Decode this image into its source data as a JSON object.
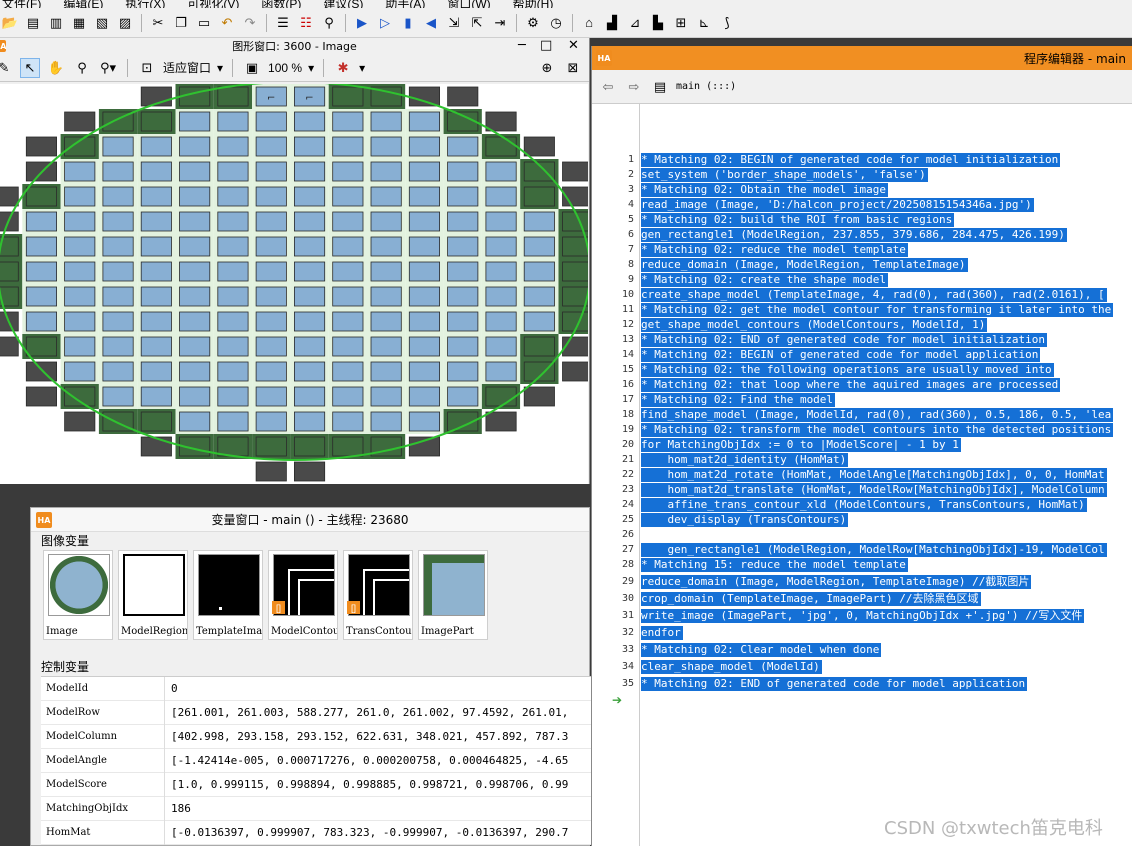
{
  "menu": [
    "文件(F)",
    "编辑(E)",
    "执行(X)",
    "可视化(V)",
    "函数(P)",
    "建议(S)",
    "助手(A)",
    "窗口(W)",
    "帮助(H)"
  ],
  "graphics_window": {
    "title": "图形窗口: 3600 - Image",
    "fit_label": "适应窗口",
    "zoom_label": "100 %"
  },
  "variable_window": {
    "title": "变量窗口 - main () - 主线程: 23680",
    "iconic_section": "图像变量",
    "control_section": "控制变量",
    "iconic_vars": [
      {
        "name": "Image",
        "kind": "wafer",
        "badge": ""
      },
      {
        "name": "ModelRegion",
        "kind": "white",
        "badge": ""
      },
      {
        "name": "TemplateImage",
        "kind": "black-dot",
        "badge": ""
      },
      {
        "name": "ModelContours",
        "kind": "contours",
        "badge": "[]"
      },
      {
        "name": "TransContours",
        "kind": "contours2",
        "badge": "[]"
      },
      {
        "name": "ImagePart",
        "kind": "part",
        "badge": ""
      }
    ],
    "control_vars": [
      {
        "name": "ModelId",
        "value": "0"
      },
      {
        "name": "ModelRow",
        "value": "[261.001, 261.003, 588.277, 261.0, 261.002, 97.4592, 261.01,"
      },
      {
        "name": "ModelColumn",
        "value": "[402.998, 293.158, 293.152, 622.631, 348.021, 457.892, 787.3"
      },
      {
        "name": "ModelAngle",
        "value": "[-1.42414e-005, 0.000717276, 0.000200758, 0.000464825, -4.65"
      },
      {
        "name": "ModelScore",
        "value": "[1.0, 0.999115, 0.998894, 0.998885, 0.998721, 0.998706, 0.99"
      },
      {
        "name": "MatchingObjIdx",
        "value": "186"
      },
      {
        "name": "HomMat",
        "value": "[-0.0136397, 0.999907, 783.323, -0.999907, -0.0136397, 290.7"
      }
    ]
  },
  "program_editor": {
    "title": "程序编辑器 - main",
    "procedure": "main (:::)",
    "lines": [
      "* Matching 02: BEGIN of generated code for model initialization",
      "set_system ('border_shape_models', 'false')",
      "* Matching 02: Obtain the model image",
      "read_image (Image, 'D:/halcon_project/20250815154346a.jpg')",
      "* Matching 02: build the ROI from basic regions",
      "gen_rectangle1 (ModelRegion, 237.855, 379.686, 284.475, 426.199)",
      "* Matching 02: reduce the model template",
      "reduce_domain (Image, ModelRegion, TemplateImage)",
      "* Matching 02: create the shape model",
      "create_shape_model (TemplateImage, 4, rad(0), rad(360), rad(2.0161), [",
      "* Matching 02: get the model contour for transforming it later into the",
      "get_shape_model_contours (ModelContours, ModelId, 1)",
      "* Matching 02: END of generated code for model initialization",
      "* Matching 02: BEGIN of generated code for model application",
      "* Matching 02: the following operations are usually moved into",
      "* Matching 02: that loop where the aquired images are processed",
      "* Matching 02: Find the model",
      "find_shape_model (Image, ModelId, rad(0), rad(360), 0.5, 186, 0.5, 'lea",
      "* Matching 02: transform the model contours into the detected positions",
      "for MatchingObjIdx := 0 to |ModelScore| - 1 by 1",
      "    hom_mat2d_identity (HomMat)",
      "    hom_mat2d_rotate (HomMat, ModelAngle[MatchingObjIdx], 0, 0, HomMat",
      "    hom_mat2d_translate (HomMat, ModelRow[MatchingObjIdx], ModelColumn",
      "    affine_trans_contour_xld (ModelContours, TransContours, HomMat)",
      "    dev_display (TransContours)",
      "",
      "    gen_rectangle1 (ModelRegion, ModelRow[MatchingObjIdx]-19, ModelCol",
      "* Matching 15: reduce the model template",
      "reduce_domain (Image, ModelRegion, TemplateImage) //截取图片",
      "crop_domain (TemplateImage, ImagePart) //去除黑色区域",
      "write_image (ImagePart, 'jpg', 0, MatchingObjIdx +'.jpg') //写入文件",
      "endfor",
      "* Matching 02: Clear model when done",
      "clear_shape_model (ModelId)",
      "* Matching 02: END of generated code for model application"
    ]
  },
  "watermark": "CSDN @txwtech笛克电科",
  "colors": {
    "accent_orange": "#f18f22",
    "selection_blue": "#1570d6",
    "die_blue": "#88afd3",
    "die_green": "#3d6b3d",
    "die_dark": "#4a4a4a",
    "grid_light": "#e3f2df",
    "ellipse_green": "#2fc22f"
  }
}
